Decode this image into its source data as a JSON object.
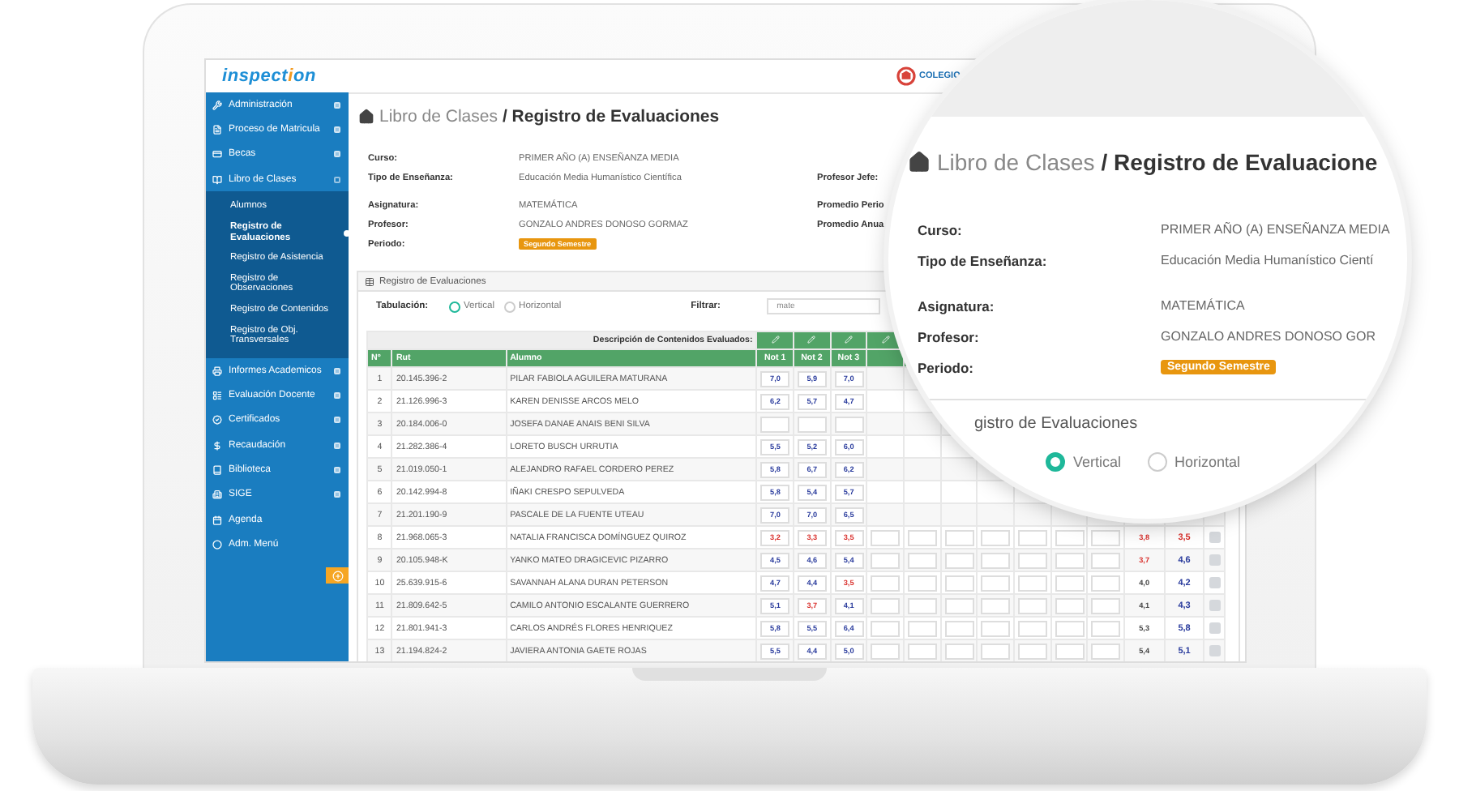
{
  "logo": {
    "before": "inspect",
    "accent": "i",
    "after": "on"
  },
  "topbar": {
    "school": "COLEGIO"
  },
  "sidebar": {
    "items": [
      {
        "label": "Administración",
        "expanded": false
      },
      {
        "label": "Proceso de Matricula",
        "expanded": false
      },
      {
        "label": "Becas",
        "expanded": false
      },
      {
        "label": "Libro de Clases",
        "expanded": true,
        "children": [
          {
            "label": "Alumnos",
            "selected": false
          },
          {
            "label": "Registro de Evaluaciones",
            "selected": true
          },
          {
            "label": "Registro de Asistencia",
            "selected": false
          },
          {
            "label": "Registro de Observaciones",
            "selected": false
          },
          {
            "label": "Registro de Contenidos",
            "selected": false
          },
          {
            "label": "Registro de Obj. Transversales",
            "selected": false
          }
        ]
      },
      {
        "label": "Informes Academicos",
        "expanded": false
      },
      {
        "label": "Evaluación Docente",
        "expanded": false
      },
      {
        "label": "Certificados",
        "expanded": false
      },
      {
        "label": "Recaudación",
        "expanded": false
      },
      {
        "label": "Biblioteca",
        "expanded": false
      },
      {
        "label": "SIGE",
        "expanded": false
      },
      {
        "label": "Agenda"
      },
      {
        "label": "Adm. Menú"
      }
    ]
  },
  "breadcrumb": {
    "parent": "Libro de Clases",
    "current": "/ Registro de Evaluaciones"
  },
  "info": {
    "groups": [
      [
        {
          "label": "Curso:",
          "value": "PRIMER AÑO (A) ENSEÑANZA MEDIA",
          "kind": "text"
        },
        {
          "label": "Tipo de Enseñanza:",
          "value": "Educación Media Humanístico Científica",
          "kind": "text",
          "side": "Profesor Jefe:"
        }
      ],
      [
        {
          "label": "Asignatura:",
          "value": "MATEMÁTICA",
          "kind": "text",
          "side": "Promedio Perio"
        },
        {
          "label": "Profesor:",
          "value": "GONZALO ANDRES DONOSO GORMAZ",
          "kind": "text",
          "side": "Promedio Anua"
        },
        {
          "label": "Periodo:",
          "value": "Segundo Semestre",
          "kind": "badge"
        }
      ]
    ]
  },
  "panel": {
    "title": "Registro de Evaluaciones",
    "tabulation_label": "Tabulación:",
    "options": [
      {
        "label": "Vertical",
        "selected": true
      },
      {
        "label": "Horizontal",
        "selected": false
      }
    ],
    "filter_label": "Filtrar:",
    "filter_value": "mate"
  },
  "table": {
    "description": "Descripción de Contenidos Evaluados:",
    "columns": [
      "Nº",
      "Rut",
      "Alumno",
      "Not 1",
      "Not 2",
      "Not 3"
    ],
    "rows": [
      {
        "n": "1",
        "rut": "20.145.396-2",
        "name": "PILAR FABIOLA AGUILERA MATURANA",
        "grades": [
          {
            "value": "7,0",
            "low": false
          },
          {
            "value": "5,9",
            "low": false
          },
          {
            "value": "7,0",
            "low": false
          }
        ]
      },
      {
        "n": "2",
        "rut": "21.126.996-3",
        "name": "KAREN DENISSE ARCOS MELO",
        "grades": [
          {
            "value": "6,2",
            "low": false
          },
          {
            "value": "5,7",
            "low": false
          },
          {
            "value": "4,7",
            "low": false
          }
        ]
      },
      {
        "n": "3",
        "rut": "20.184.006-0",
        "name": "JOSEFA DANAE ANAIS BENI SILVA",
        "grades": []
      },
      {
        "n": "4",
        "rut": "21.282.386-4",
        "name": "LORETO BUSCH URRUTIA",
        "grades": [
          {
            "value": "5,5",
            "low": false
          },
          {
            "value": "5,2",
            "low": false
          },
          {
            "value": "6,0",
            "low": false
          }
        ]
      },
      {
        "n": "5",
        "rut": "21.019.050-1",
        "name": "ALEJANDRO RAFAEL CORDERO PEREZ",
        "grades": [
          {
            "value": "5,8",
            "low": false
          },
          {
            "value": "6,7",
            "low": false
          },
          {
            "value": "6,2",
            "low": false
          }
        ]
      },
      {
        "n": "6",
        "rut": "20.142.994-8",
        "name": "IÑAKI CRESPO SEPULVEDA",
        "grades": [
          {
            "value": "5,8",
            "low": false
          },
          {
            "value": "5,4",
            "low": false
          },
          {
            "value": "5,7",
            "low": false
          }
        ]
      },
      {
        "n": "7",
        "rut": "21.201.190-9",
        "name": "PASCALE DE LA FUENTE UTEAU",
        "grades": [
          {
            "value": "7,0",
            "low": false
          },
          {
            "value": "7,0",
            "low": false
          },
          {
            "value": "6,5",
            "low": false
          }
        ]
      },
      {
        "n": "8",
        "rut": "21.968.065-3",
        "name": "NATALIA FRANCISCA DOMÍNGUEZ QUIROZ",
        "grades": [
          {
            "value": "3,2",
            "low": true
          },
          {
            "value": "3,3",
            "low": true
          },
          {
            "value": "3,5",
            "low": true
          }
        ],
        "average": {
          "value": "3,8",
          "low": true
        },
        "final": {
          "value": "3,5",
          "low": true
        },
        "checked": false
      },
      {
        "n": "9",
        "rut": "20.105.948-K",
        "name": "YANKO MATEO DRAGICEVIC PIZARRO",
        "grades": [
          {
            "value": "4,5",
            "low": false
          },
          {
            "value": "4,6",
            "low": false
          },
          {
            "value": "5,4",
            "low": false
          }
        ],
        "average": {
          "value": "3,7",
          "low": true
        },
        "final": {
          "value": "4,6",
          "low": false
        },
        "checked": false
      },
      {
        "n": "10",
        "rut": "25.639.915-6",
        "name": "SAVANNAH ALANA DURAN PETERSON",
        "grades": [
          {
            "value": "4,7",
            "low": false
          },
          {
            "value": "4,4",
            "low": false
          },
          {
            "value": "3,5",
            "low": true
          }
        ],
        "average": {
          "value": "4,0",
          "low": false
        },
        "final": {
          "value": "4,2",
          "low": false
        },
        "checked": false
      },
      {
        "n": "11",
        "rut": "21.809.642-5",
        "name": "CAMILO ANTONIO ESCALANTE GUERRERO",
        "grades": [
          {
            "value": "5,1",
            "low": false
          },
          {
            "value": "3,7",
            "low": true
          },
          {
            "value": "4,1",
            "low": false
          }
        ],
        "average": {
          "value": "4,1",
          "low": false
        },
        "final": {
          "value": "4,3",
          "low": false
        },
        "checked": false
      },
      {
        "n": "12",
        "rut": "21.801.941-3",
        "name": "CARLOS ANDRÉS FLORES HENRIQUEZ",
        "grades": [
          {
            "value": "5,8",
            "low": false
          },
          {
            "value": "5,5",
            "low": false
          },
          {
            "value": "6,4",
            "low": false
          }
        ],
        "average": {
          "value": "5,3",
          "low": false
        },
        "final": {
          "value": "5,8",
          "low": false
        },
        "checked": false
      },
      {
        "n": "13",
        "rut": "21.194.824-2",
        "name": "JAVIERA ANTONIA GAETE ROJAS",
        "grades": [
          {
            "value": "5,5",
            "low": false
          },
          {
            "value": "4,4",
            "low": false
          },
          {
            "value": "5,0",
            "low": false
          }
        ],
        "average": {
          "value": "5,4",
          "low": false
        },
        "final": {
          "value": "5,1",
          "low": false
        },
        "checked": false
      }
    ]
  },
  "magnifier": {
    "breadcrumb": {
      "parent": "Libro de Clases",
      "current": "/ Registro de Evaluacione"
    },
    "groups": [
      [
        {
          "label": "Curso:",
          "value": "PRIMER AÑO (A) ENSEÑANZA MEDIA",
          "kind": "text"
        },
        {
          "label": "Tipo de Enseñanza:",
          "value": "Educación Media Humanístico Cientí",
          "kind": "text"
        }
      ],
      [
        {
          "label": "Asignatura:",
          "value": "MATEMÁTICA",
          "kind": "text"
        },
        {
          "label": "Profesor:",
          "value": "GONZALO ANDRES DONOSO GOR",
          "kind": "text"
        },
        {
          "label": "Periodo:",
          "value": "Segundo Semestre",
          "kind": "badge"
        }
      ]
    ],
    "panel_title": "gistro de Evaluaciones",
    "options": [
      {
        "label": "Vertical",
        "selected": true
      },
      {
        "label": "Horizontal",
        "selected": false
      }
    ]
  }
}
